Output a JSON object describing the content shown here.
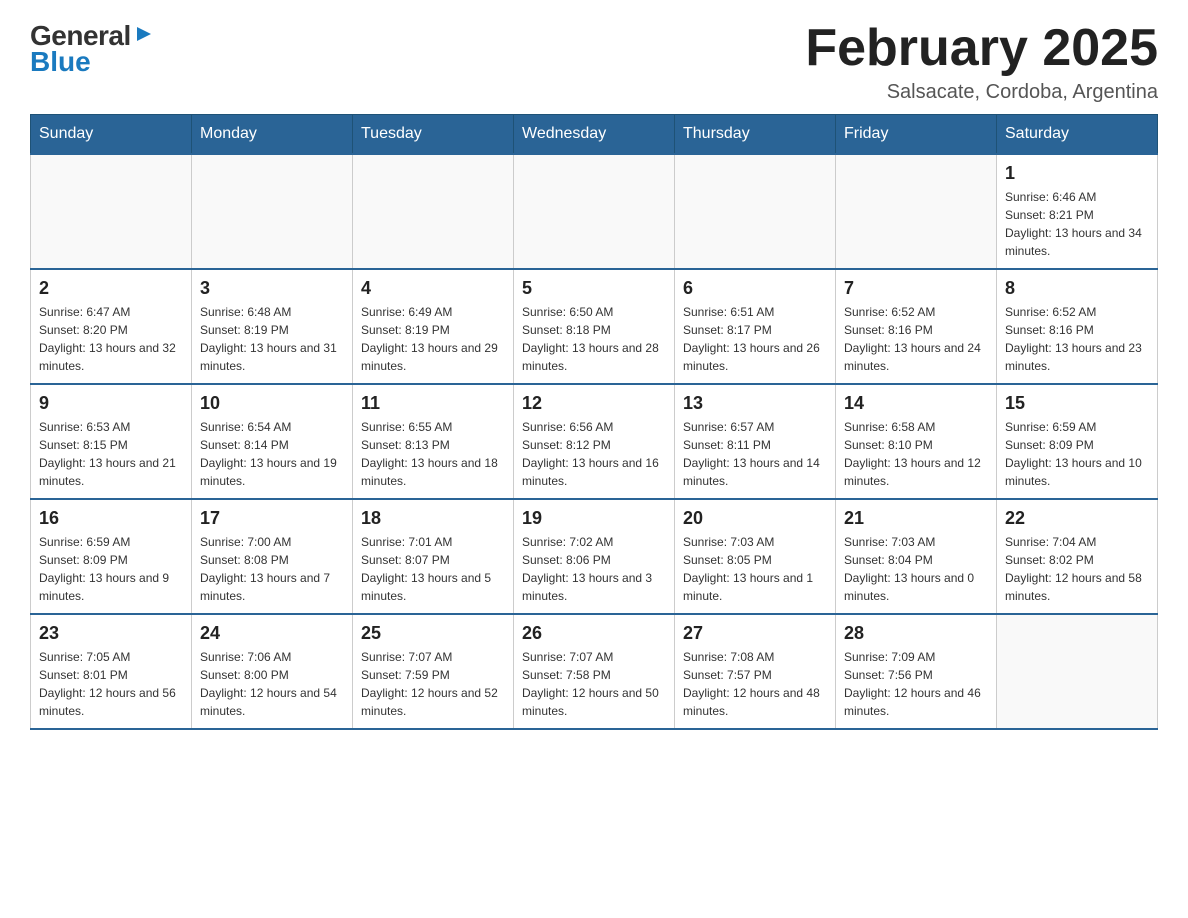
{
  "logo": {
    "general": "General",
    "blue": "Blue",
    "arrow": "▶"
  },
  "title": "February 2025",
  "location": "Salsacate, Cordoba, Argentina",
  "weekdays": [
    "Sunday",
    "Monday",
    "Tuesday",
    "Wednesday",
    "Thursday",
    "Friday",
    "Saturday"
  ],
  "weeks": [
    [
      {
        "day": "",
        "info": ""
      },
      {
        "day": "",
        "info": ""
      },
      {
        "day": "",
        "info": ""
      },
      {
        "day": "",
        "info": ""
      },
      {
        "day": "",
        "info": ""
      },
      {
        "day": "",
        "info": ""
      },
      {
        "day": "1",
        "info": "Sunrise: 6:46 AM\nSunset: 8:21 PM\nDaylight: 13 hours and 34 minutes."
      }
    ],
    [
      {
        "day": "2",
        "info": "Sunrise: 6:47 AM\nSunset: 8:20 PM\nDaylight: 13 hours and 32 minutes."
      },
      {
        "day": "3",
        "info": "Sunrise: 6:48 AM\nSunset: 8:19 PM\nDaylight: 13 hours and 31 minutes."
      },
      {
        "day": "4",
        "info": "Sunrise: 6:49 AM\nSunset: 8:19 PM\nDaylight: 13 hours and 29 minutes."
      },
      {
        "day": "5",
        "info": "Sunrise: 6:50 AM\nSunset: 8:18 PM\nDaylight: 13 hours and 28 minutes."
      },
      {
        "day": "6",
        "info": "Sunrise: 6:51 AM\nSunset: 8:17 PM\nDaylight: 13 hours and 26 minutes."
      },
      {
        "day": "7",
        "info": "Sunrise: 6:52 AM\nSunset: 8:16 PM\nDaylight: 13 hours and 24 minutes."
      },
      {
        "day": "8",
        "info": "Sunrise: 6:52 AM\nSunset: 8:16 PM\nDaylight: 13 hours and 23 minutes."
      }
    ],
    [
      {
        "day": "9",
        "info": "Sunrise: 6:53 AM\nSunset: 8:15 PM\nDaylight: 13 hours and 21 minutes."
      },
      {
        "day": "10",
        "info": "Sunrise: 6:54 AM\nSunset: 8:14 PM\nDaylight: 13 hours and 19 minutes."
      },
      {
        "day": "11",
        "info": "Sunrise: 6:55 AM\nSunset: 8:13 PM\nDaylight: 13 hours and 18 minutes."
      },
      {
        "day": "12",
        "info": "Sunrise: 6:56 AM\nSunset: 8:12 PM\nDaylight: 13 hours and 16 minutes."
      },
      {
        "day": "13",
        "info": "Sunrise: 6:57 AM\nSunset: 8:11 PM\nDaylight: 13 hours and 14 minutes."
      },
      {
        "day": "14",
        "info": "Sunrise: 6:58 AM\nSunset: 8:10 PM\nDaylight: 13 hours and 12 minutes."
      },
      {
        "day": "15",
        "info": "Sunrise: 6:59 AM\nSunset: 8:09 PM\nDaylight: 13 hours and 10 minutes."
      }
    ],
    [
      {
        "day": "16",
        "info": "Sunrise: 6:59 AM\nSunset: 8:09 PM\nDaylight: 13 hours and 9 minutes."
      },
      {
        "day": "17",
        "info": "Sunrise: 7:00 AM\nSunset: 8:08 PM\nDaylight: 13 hours and 7 minutes."
      },
      {
        "day": "18",
        "info": "Sunrise: 7:01 AM\nSunset: 8:07 PM\nDaylight: 13 hours and 5 minutes."
      },
      {
        "day": "19",
        "info": "Sunrise: 7:02 AM\nSunset: 8:06 PM\nDaylight: 13 hours and 3 minutes."
      },
      {
        "day": "20",
        "info": "Sunrise: 7:03 AM\nSunset: 8:05 PM\nDaylight: 13 hours and 1 minute."
      },
      {
        "day": "21",
        "info": "Sunrise: 7:03 AM\nSunset: 8:04 PM\nDaylight: 13 hours and 0 minutes."
      },
      {
        "day": "22",
        "info": "Sunrise: 7:04 AM\nSunset: 8:02 PM\nDaylight: 12 hours and 58 minutes."
      }
    ],
    [
      {
        "day": "23",
        "info": "Sunrise: 7:05 AM\nSunset: 8:01 PM\nDaylight: 12 hours and 56 minutes."
      },
      {
        "day": "24",
        "info": "Sunrise: 7:06 AM\nSunset: 8:00 PM\nDaylight: 12 hours and 54 minutes."
      },
      {
        "day": "25",
        "info": "Sunrise: 7:07 AM\nSunset: 7:59 PM\nDaylight: 12 hours and 52 minutes."
      },
      {
        "day": "26",
        "info": "Sunrise: 7:07 AM\nSunset: 7:58 PM\nDaylight: 12 hours and 50 minutes."
      },
      {
        "day": "27",
        "info": "Sunrise: 7:08 AM\nSunset: 7:57 PM\nDaylight: 12 hours and 48 minutes."
      },
      {
        "day": "28",
        "info": "Sunrise: 7:09 AM\nSunset: 7:56 PM\nDaylight: 12 hours and 46 minutes."
      },
      {
        "day": "",
        "info": ""
      }
    ]
  ]
}
